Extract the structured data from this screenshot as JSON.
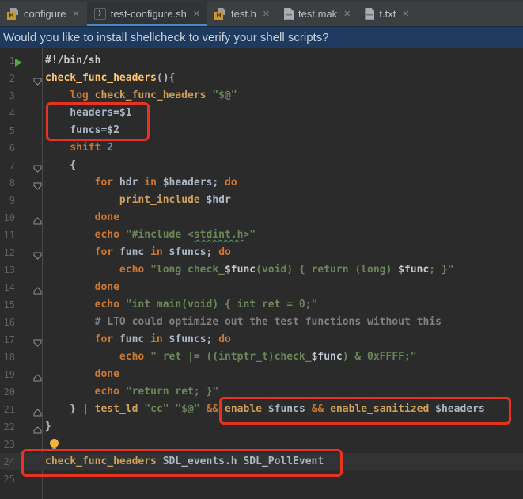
{
  "glyphs": {
    "header_letter": "H",
    "shell_prompt": "❯",
    "close": "✕"
  },
  "colors": {
    "tab_underline": "#4a88c7",
    "notification_bg": "#1e3a5e",
    "editor_bg": "#2b2b2b",
    "annotation_red": "#e8331f",
    "keyword_orange": "#cc7832",
    "string_green": "#6a8759",
    "function_tan": "#d0a05a",
    "declaration_yellow": "#ffc66d"
  },
  "tabs": {
    "items": [
      {
        "label": "configure",
        "icon": "header-file",
        "active": false
      },
      {
        "label": "test-configure.sh",
        "icon": "shell-script",
        "active": true
      },
      {
        "label": "test.h",
        "icon": "header-file",
        "active": false
      },
      {
        "label": "test.mak",
        "icon": "text-file",
        "active": false
      },
      {
        "label": "t.txt",
        "icon": "text-file",
        "active": false
      }
    ]
  },
  "notification": {
    "message": "Would you like to install shellcheck to verify your shell scripts?"
  },
  "editor": {
    "lines": [
      {
        "num": 1,
        "marker": "run",
        "tokens": [
          [
            "sb",
            "#!/bin/sh"
          ]
        ]
      },
      {
        "num": 2,
        "marker": "fold-down",
        "tokens": [
          [
            "decl",
            "check_func_headers"
          ],
          [
            "pl",
            "(){"
          ]
        ]
      },
      {
        "num": 3,
        "tokens": [
          [
            "pl",
            "    "
          ],
          [
            "kw",
            "log"
          ],
          [
            "pl",
            " "
          ],
          [
            "fn",
            "check_func_headers"
          ],
          [
            "pl",
            " "
          ],
          [
            "str",
            "\"$@\""
          ]
        ]
      },
      {
        "num": 4,
        "tokens": [
          [
            "pl",
            "    headers=$1"
          ]
        ]
      },
      {
        "num": 5,
        "tokens": [
          [
            "pl",
            "    funcs=$2"
          ]
        ]
      },
      {
        "num": 6,
        "tokens": [
          [
            "pl",
            "    "
          ],
          [
            "kw",
            "shift"
          ],
          [
            "pl",
            " "
          ],
          [
            "num",
            "2"
          ]
        ]
      },
      {
        "num": 7,
        "marker": "fold-down",
        "tokens": [
          [
            "pl",
            "    {"
          ]
        ]
      },
      {
        "num": 8,
        "marker": "fold-down",
        "tokens": [
          [
            "pl",
            "        "
          ],
          [
            "kw",
            "for"
          ],
          [
            "pl",
            " hdr "
          ],
          [
            "kw",
            "in"
          ],
          [
            "pl",
            " $headers; "
          ],
          [
            "kw",
            "do"
          ]
        ]
      },
      {
        "num": 9,
        "tokens": [
          [
            "pl",
            "            "
          ],
          [
            "fn",
            "print_include"
          ],
          [
            "pl",
            " $hdr"
          ]
        ]
      },
      {
        "num": 10,
        "marker": "fold-up",
        "tokens": [
          [
            "pl",
            "        "
          ],
          [
            "kw",
            "done"
          ]
        ]
      },
      {
        "num": 11,
        "tokens": [
          [
            "pl",
            "        "
          ],
          [
            "kw",
            "echo"
          ],
          [
            "pl",
            " "
          ],
          [
            "str",
            "\"#include <"
          ],
          [
            "strw",
            "stdint.h"
          ],
          [
            "str",
            ">\""
          ]
        ]
      },
      {
        "num": 12,
        "marker": "fold-down",
        "tokens": [
          [
            "pl",
            "        "
          ],
          [
            "kw",
            "for"
          ],
          [
            "pl",
            " func "
          ],
          [
            "kw",
            "in"
          ],
          [
            "pl",
            " $funcs; "
          ],
          [
            "kw",
            "do"
          ]
        ]
      },
      {
        "num": 13,
        "tokens": [
          [
            "pl",
            "            "
          ],
          [
            "kw",
            "echo"
          ],
          [
            "pl",
            " "
          ],
          [
            "str",
            "\"long check_"
          ],
          [
            "vin",
            "$func"
          ],
          [
            "str",
            "(void) { return (long) "
          ],
          [
            "vin",
            "$func"
          ],
          [
            "str",
            "; }\""
          ]
        ]
      },
      {
        "num": 14,
        "marker": "fold-up",
        "tokens": [
          [
            "pl",
            "        "
          ],
          [
            "kw",
            "done"
          ]
        ]
      },
      {
        "num": 15,
        "tokens": [
          [
            "pl",
            "        "
          ],
          [
            "kw",
            "echo"
          ],
          [
            "pl",
            " "
          ],
          [
            "str",
            "\"int main(void) { int ret = 0;\""
          ]
        ]
      },
      {
        "num": 16,
        "tokens": [
          [
            "pl",
            "        "
          ],
          [
            "com",
            "# LTO could optimize out the test functions without this"
          ]
        ]
      },
      {
        "num": 17,
        "marker": "fold-down",
        "tokens": [
          [
            "pl",
            "        "
          ],
          [
            "kw",
            "for"
          ],
          [
            "pl",
            " func "
          ],
          [
            "kw",
            "in"
          ],
          [
            "pl",
            " $funcs; "
          ],
          [
            "kw",
            "do"
          ]
        ]
      },
      {
        "num": 18,
        "tokens": [
          [
            "pl",
            "            "
          ],
          [
            "kw",
            "echo"
          ],
          [
            "pl",
            " "
          ],
          [
            "str",
            "\" ret |= ((intptr_t)check_"
          ],
          [
            "vin",
            "$func"
          ],
          [
            "str",
            ") & 0xFFFF;\""
          ]
        ]
      },
      {
        "num": 19,
        "marker": "fold-up",
        "tokens": [
          [
            "pl",
            "        "
          ],
          [
            "kw",
            "done"
          ]
        ]
      },
      {
        "num": 20,
        "tokens": [
          [
            "pl",
            "        "
          ],
          [
            "kw",
            "echo"
          ],
          [
            "pl",
            " "
          ],
          [
            "str",
            "\"return ret; }\""
          ]
        ]
      },
      {
        "num": 21,
        "marker": "fold-up",
        "tokens": [
          [
            "pl",
            "    } | "
          ],
          [
            "fn",
            "test_ld"
          ],
          [
            "pl",
            " "
          ],
          [
            "str",
            "\"cc\""
          ],
          [
            "pl",
            " "
          ],
          [
            "str",
            "\"$@\""
          ],
          [
            "pl",
            " "
          ],
          [
            "kw",
            "&&"
          ],
          [
            "pl",
            " "
          ],
          [
            "fn",
            "enable"
          ],
          [
            "pl",
            " $funcs "
          ],
          [
            "kw",
            "&&"
          ],
          [
            "pl",
            " "
          ],
          [
            "fn",
            "enable_sanitized"
          ],
          [
            "pl",
            " $headers"
          ]
        ]
      },
      {
        "num": 22,
        "marker": "fold-up",
        "tokens": [
          [
            "pl",
            "}"
          ]
        ]
      },
      {
        "num": 23,
        "bulb": true,
        "tokens": []
      },
      {
        "num": 24,
        "current": true,
        "tokens": [
          [
            "fn",
            "check_func_headers"
          ],
          [
            "pl",
            " SDL_events.h SDL_PollEvent"
          ]
        ]
      },
      {
        "num": 25,
        "tokens": []
      }
    ]
  }
}
